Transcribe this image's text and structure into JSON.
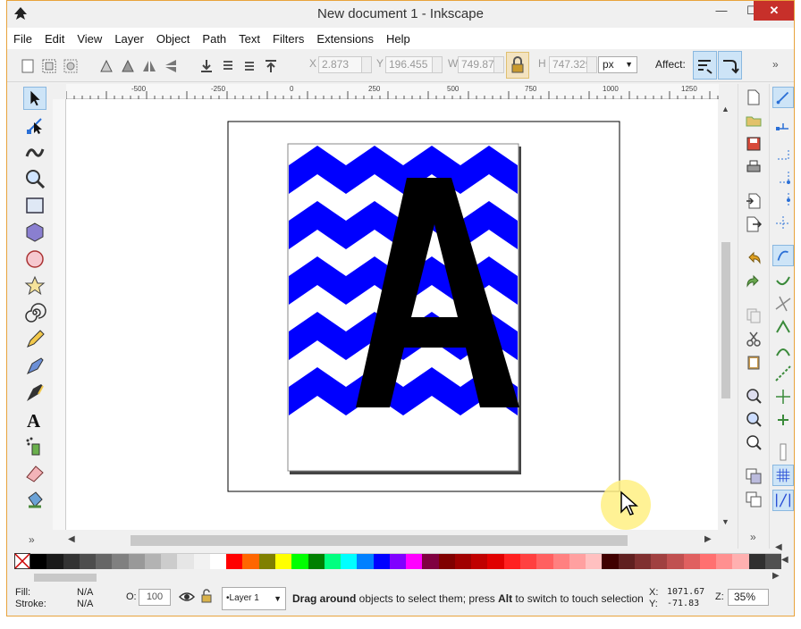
{
  "window": {
    "title": "New document 1 - Inkscape",
    "minimize": "—",
    "maximize": "☐",
    "close": "✕"
  },
  "menu": [
    "File",
    "Edit",
    "View",
    "Layer",
    "Object",
    "Path",
    "Text",
    "Filters",
    "Extensions",
    "Help"
  ],
  "toolbar": {
    "x_label": "X",
    "x_value": "2.873",
    "y_label": "Y",
    "y_value": "196.455",
    "w_label": "W",
    "w_value": "749.878",
    "h_label": "H",
    "h_value": "747.329",
    "unit": "px",
    "affect_label": "Affect:"
  },
  "ruler": {
    "labels": [
      "-500",
      "-250",
      "0",
      "250",
      "500",
      "750",
      "1000",
      "1250"
    ]
  },
  "canvas": {
    "letter": "A",
    "colors": {
      "chevron": "#0000ff",
      "letter": "#000000",
      "page_border": "#000000"
    }
  },
  "palette": [
    "#000000",
    "#1a1a1a",
    "#333333",
    "#4d4d4d",
    "#666666",
    "#808080",
    "#999999",
    "#b3b3b3",
    "#cccccc",
    "#e6e6e6",
    "#f2f2f2",
    "#ffffff",
    "#ff0000",
    "#ff6600",
    "#808000",
    "#ffff00",
    "#00ff00",
    "#008000",
    "#00ff80",
    "#00ffff",
    "#0080ff",
    "#0000ff",
    "#8000ff",
    "#ff00ff",
    "#800040",
    "#800000",
    "#a00000",
    "#c00000",
    "#e00000",
    "#ff2020",
    "#ff4040",
    "#ff6060",
    "#ff8080",
    "#ffa0a0",
    "#ffc0c0",
    "#400000",
    "#602020",
    "#803030",
    "#a04040",
    "#c05050",
    "#e06060",
    "#ff7070",
    "#ff9090",
    "#ffb0b0",
    "#303030",
    "#505050"
  ],
  "status": {
    "fill_label": "Fill:",
    "fill_value": "N/A",
    "stroke_label": "Stroke:",
    "stroke_value": "N/A",
    "opacity_label": "O:",
    "opacity_value": "100",
    "layer": "•Layer 1",
    "msg_bold1": "Drag around",
    "msg_part1": " objects to select them; press ",
    "msg_bold2": "Alt",
    "msg_part2": " to switch to touch selection",
    "cx_label": "X:",
    "cx": "1071.67",
    "cy_label": "Y:",
    "cy": "-71.83",
    "zoom_label": "Z:",
    "zoom": "35%"
  },
  "overflow_icons": "»"
}
